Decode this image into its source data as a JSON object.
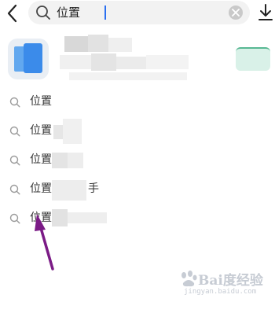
{
  "search": {
    "query": "位置"
  },
  "suggestions": [
    {
      "text": "位置"
    },
    {
      "text": "位置"
    },
    {
      "text": "位置"
    },
    {
      "text": "位置",
      "suffix": "手"
    },
    {
      "text": "位置"
    }
  ],
  "watermark": {
    "main": "Bai度经验",
    "sub": "jingyan.baidu.com"
  },
  "colors": {
    "accent": "#2a6ff0",
    "arrow": "#7b1b86",
    "app_icon_blue": "#3b8bea",
    "action_green": "#58b893"
  },
  "icons": {
    "back": "chevron-left-icon",
    "search": "search-icon",
    "clear": "close-icon",
    "download": "download-icon"
  }
}
